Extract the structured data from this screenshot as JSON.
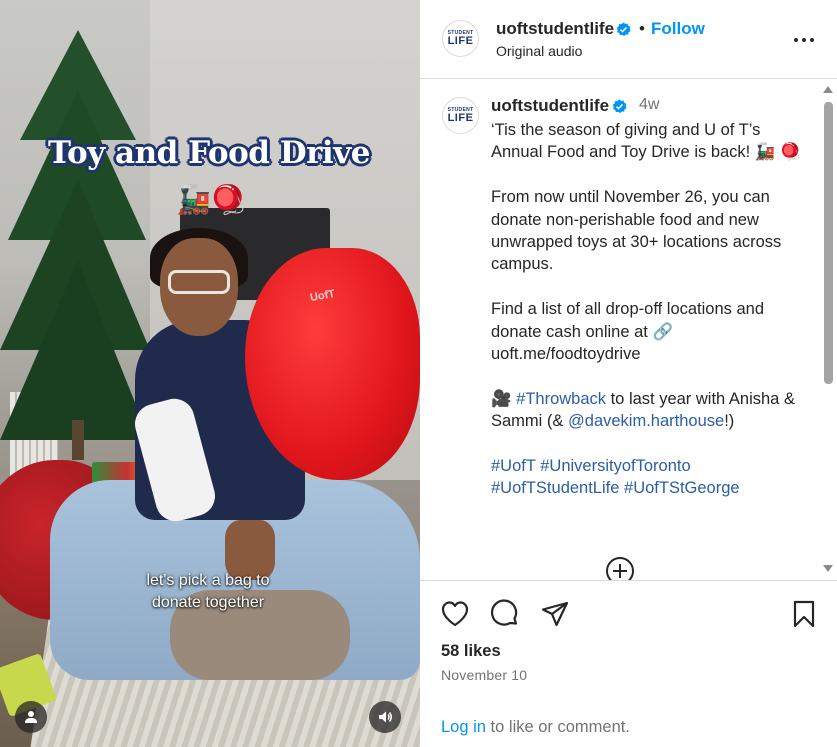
{
  "video": {
    "overlay_title": "Toy and Food Drive",
    "overlay_emoji": [
      "🚂",
      "🪀"
    ],
    "subtitle_line1": "let's pick a bag to",
    "subtitle_line2": "donate together",
    "bag_print": "UofT",
    "user_button_icon": "user-icon",
    "sound_button_icon": "speaker-icon"
  },
  "header": {
    "username": "uoftstudentlife",
    "separator": "•",
    "follow_label": "Follow",
    "audio_label": "Original audio",
    "avatar_text_top": "STUDENT",
    "avatar_text_main": "LIFE"
  },
  "caption": {
    "username": "uoftstudentlife",
    "time": "4w",
    "para1": "‘Tis the season of giving and U of T’s Annual Food and Toy Drive is back! 🚂 🪀",
    "para2": "From now until November 26, you can donate non-perishable food and new unwrapped toys at 30+ locations across campus.",
    "para3_text": "Find a list of all drop-off locations and donate cash online at 🔗 uoft.me/foodtoydrive",
    "para4_emoji": "🎥",
    "para4_tag": "#Throwback",
    "para4_mid": " to last year with Anisha & Sammi (& ",
    "para4_mention": "@davekim.harthouse",
    "para4_end": "!)",
    "hashtags_line1": [
      "#UofT",
      "#UniversityofToronto"
    ],
    "hashtags_line2": [
      "#UofTStudentLife",
      "#UofTStGeorge"
    ]
  },
  "footer": {
    "likes": "58 likes",
    "date": "November 10",
    "login_link": "Log in",
    "login_rest": " to like or comment."
  },
  "colors": {
    "link_blue": "#0095f6",
    "hashtag_blue": "#2b5ea7",
    "verified_blue": "#0095f6",
    "muted": "#737373",
    "brand_navy": "#1e3471"
  }
}
